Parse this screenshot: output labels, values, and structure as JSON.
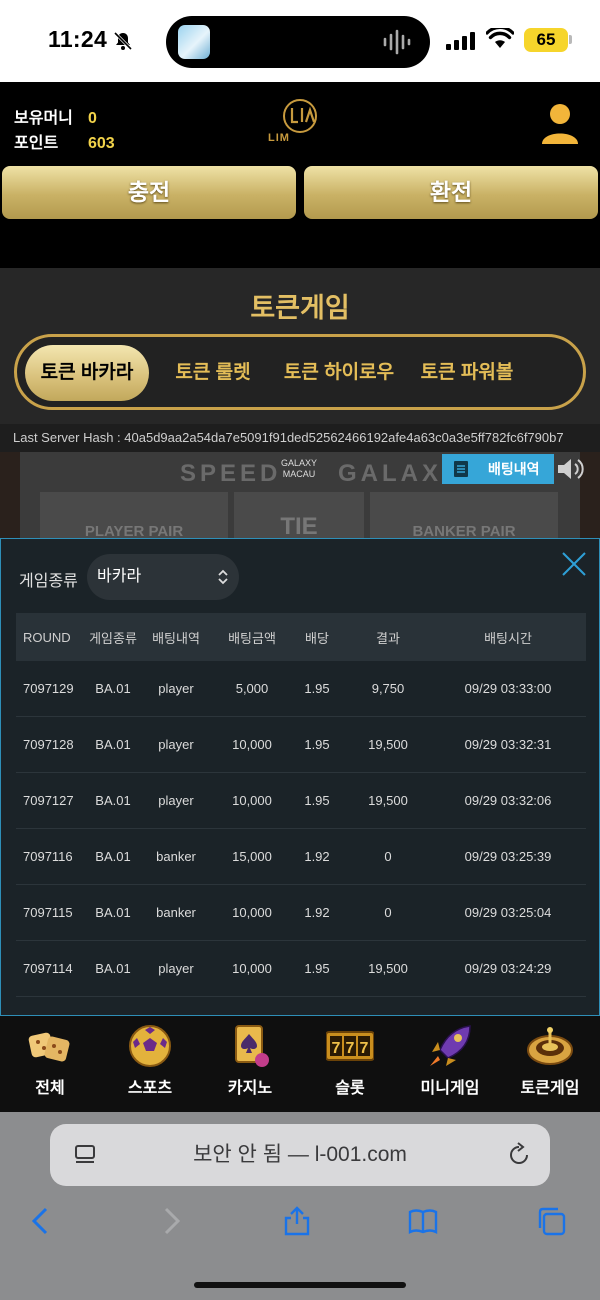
{
  "status_bar": {
    "time": "11:24",
    "battery": "65"
  },
  "header": {
    "money_label": "보유머니",
    "money_value": "0",
    "points_label": "포인트",
    "points_value": "603",
    "logo_text": "LIM",
    "charge_label": "충전",
    "exchange_label": "환전"
  },
  "token_game": {
    "title": "토큰게임",
    "tabs": [
      {
        "label": "토큰 바카라",
        "active": true
      },
      {
        "label": "토큰 룰렛"
      },
      {
        "label": "토큰 하이로우"
      },
      {
        "label": "토큰 파워볼"
      }
    ],
    "hash_text": "Last Server Hash : 40a5d9aa2a54da7e5091f91ded52562466192afe4a63c0a3e5ff782fc6f790b7"
  },
  "board": {
    "speed": "SPEED",
    "galaxy": "GALAXY",
    "galaxy_logo": "GALAXY MACAU",
    "history_label": "배팅내역",
    "player_pair": "PLAYER PAIR",
    "tie": "TIE",
    "banker_pair": "BANKER PAIR"
  },
  "modal": {
    "game_type_label": "게임종류",
    "selected_game": "바카라",
    "columns": [
      "ROUND",
      "게임종류",
      "배팅내역",
      "배팅금액",
      "배당",
      "결과",
      "배팅시간"
    ],
    "rows": [
      [
        "7097129",
        "BA.01",
        "player",
        "5,000",
        "1.95",
        "9,750",
        "09/29 03:33:00"
      ],
      [
        "7097128",
        "BA.01",
        "player",
        "10,000",
        "1.95",
        "19,500",
        "09/29 03:32:31"
      ],
      [
        "7097127",
        "BA.01",
        "player",
        "10,000",
        "1.95",
        "19,500",
        "09/29 03:32:06"
      ],
      [
        "7097116",
        "BA.01",
        "banker",
        "15,000",
        "1.92",
        "0",
        "09/29 03:25:39"
      ],
      [
        "7097115",
        "BA.01",
        "banker",
        "10,000",
        "1.92",
        "0",
        "09/29 03:25:04"
      ],
      [
        "7097114",
        "BA.01",
        "player",
        "10,000",
        "1.95",
        "19,500",
        "09/29 03:24:29"
      ]
    ]
  },
  "bottom_nav": [
    {
      "label": "전체",
      "icon": "dice-icon"
    },
    {
      "label": "스포츠",
      "icon": "soccer-ball-icon"
    },
    {
      "label": "카지노",
      "icon": "cards-icon"
    },
    {
      "label": "슬롯",
      "icon": "slot-777-icon"
    },
    {
      "label": "미니게임",
      "icon": "rocket-icon"
    },
    {
      "label": "토큰게임",
      "icon": "roulette-icon"
    }
  ],
  "browser": {
    "url_text": "보안 안 됨 — l-001.com"
  },
  "colors": {
    "gold": "#e3bf64",
    "accent_blue": "#36a6d8",
    "points_yellow": "#f2d34a"
  }
}
